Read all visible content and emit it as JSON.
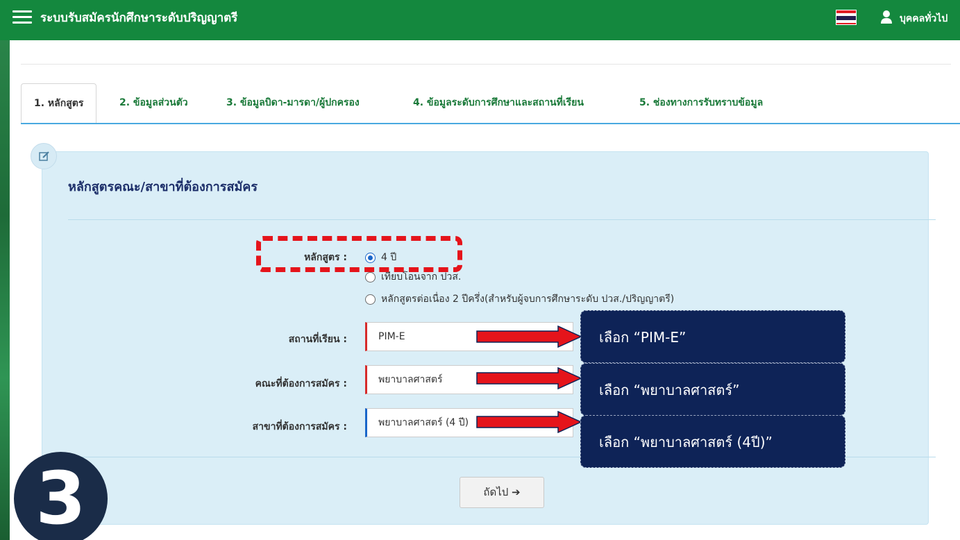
{
  "header": {
    "title": "ระบบรับสมัครนักศึกษาระดับปริญญาตรี",
    "user_label": "บุคคลทั่วไป",
    "flag_colors": [
      "#e11b22",
      "#ffffff",
      "#241d4f",
      "#ffffff",
      "#e11b22"
    ]
  },
  "tabs": [
    {
      "label": "1. หลักสูตร",
      "active": true
    },
    {
      "label": "2. ข้อมูลส่วนตัว"
    },
    {
      "label": "3. ข้อมูลบิดา-มารดา/ผู้ปกครอง"
    },
    {
      "label": "4. ข้อมูลระดับการศึกษาและสถานที่เรียน"
    },
    {
      "label": "5. ช่องทางการรับทราบข้อมูล"
    }
  ],
  "form": {
    "section_title": "หลักสูตรคณะ/สาขาที่ต้องการสมัคร",
    "program_label": "หลักสูตร :",
    "program_options": [
      {
        "label": "4 ปี",
        "checked": true
      },
      {
        "label": "เทียบโอนจาก ปวส."
      },
      {
        "label": "หลักสูตรต่อเนื่อง 2 ปีครึ่ง(สำหรับผู้จบการศึกษาระดับ ปวส./ปริญญาตรี)"
      }
    ],
    "campus_label": "สถานที่เรียน :",
    "campus_value": "PIM-E",
    "faculty_label": "คณะที่ต้องการสมัคร :",
    "faculty_value": "พยาบาลศาสตร์",
    "major_label": "สาขาที่ต้องการสมัคร :",
    "major_value": "พยาบาลศาสตร์ (4 ปี)",
    "next_label": "ถัดไป ➔"
  },
  "annotations": {
    "step_number": "3",
    "callouts": [
      "เลือก “PIM-E”",
      "เลือก “พยาบาลศาสตร์”",
      "เลือก “พยาบาลศาสตร์ (4ปี)”"
    ],
    "highlight_color": "#e5141b",
    "callout_color": "#0e2357"
  }
}
